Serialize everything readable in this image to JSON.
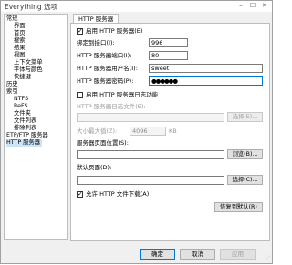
{
  "window": {
    "title": "Everything 选项"
  },
  "tree": {
    "items": [
      {
        "label": "常规",
        "level": 0
      },
      {
        "label": "界面",
        "level": 1
      },
      {
        "label": "首页",
        "level": 1
      },
      {
        "label": "搜索",
        "level": 1
      },
      {
        "label": "结果",
        "level": 1
      },
      {
        "label": "视图",
        "level": 1
      },
      {
        "label": "上下文菜单",
        "level": 1
      },
      {
        "label": "字体与颜色",
        "level": 1
      },
      {
        "label": "快捷键",
        "level": 1
      },
      {
        "label": "历史",
        "level": 0
      },
      {
        "label": "索引",
        "level": 0
      },
      {
        "label": "NTFS",
        "level": 1
      },
      {
        "label": "ReFS",
        "level": 1
      },
      {
        "label": "文件夹",
        "level": 1
      },
      {
        "label": "文件列表",
        "level": 1
      },
      {
        "label": "排除列表",
        "level": 1
      },
      {
        "label": "ETP/FTP 服务器",
        "level": 0
      },
      {
        "label": "HTTP 服务器",
        "level": 0,
        "selected": true
      }
    ]
  },
  "panel": {
    "tab": "HTTP 服务器",
    "enable_http": {
      "label": "启用 HTTP 服务器(E)",
      "checked": true
    },
    "bind_interface": {
      "label": "绑定到接口(I):",
      "value": "996"
    },
    "port": {
      "label": "HTTP 服务器端口(I):",
      "value": "80"
    },
    "username": {
      "label": "HTTP 服务器用户名(I):",
      "value": "sweet"
    },
    "password": {
      "label": "HTTP 服务器密码(P):",
      "value": "●●●●●●"
    },
    "enable_log": {
      "label": "启用 HTTP 服务器日志功能",
      "checked": false
    },
    "log_file": {
      "label": "HTTP 服务器日志文件(E):",
      "value": "",
      "button": "选择(E)..."
    },
    "log_size": {
      "label": "大小最大值(Z):",
      "value": "4096",
      "unit": "KB"
    },
    "page_location": {
      "label": "服务器页面位置(S):",
      "value": "",
      "button": "浏览(B)..."
    },
    "default_page": {
      "label": "默认页面(D):",
      "value": "",
      "button": "选择(C)..."
    },
    "allow_download": {
      "label": "允许 HTTP 文件下载(A)",
      "checked": true
    },
    "restore_default": "恢复到默认(R)"
  },
  "footer": {
    "ok": "确定",
    "cancel": "取消",
    "apply": "应用"
  }
}
